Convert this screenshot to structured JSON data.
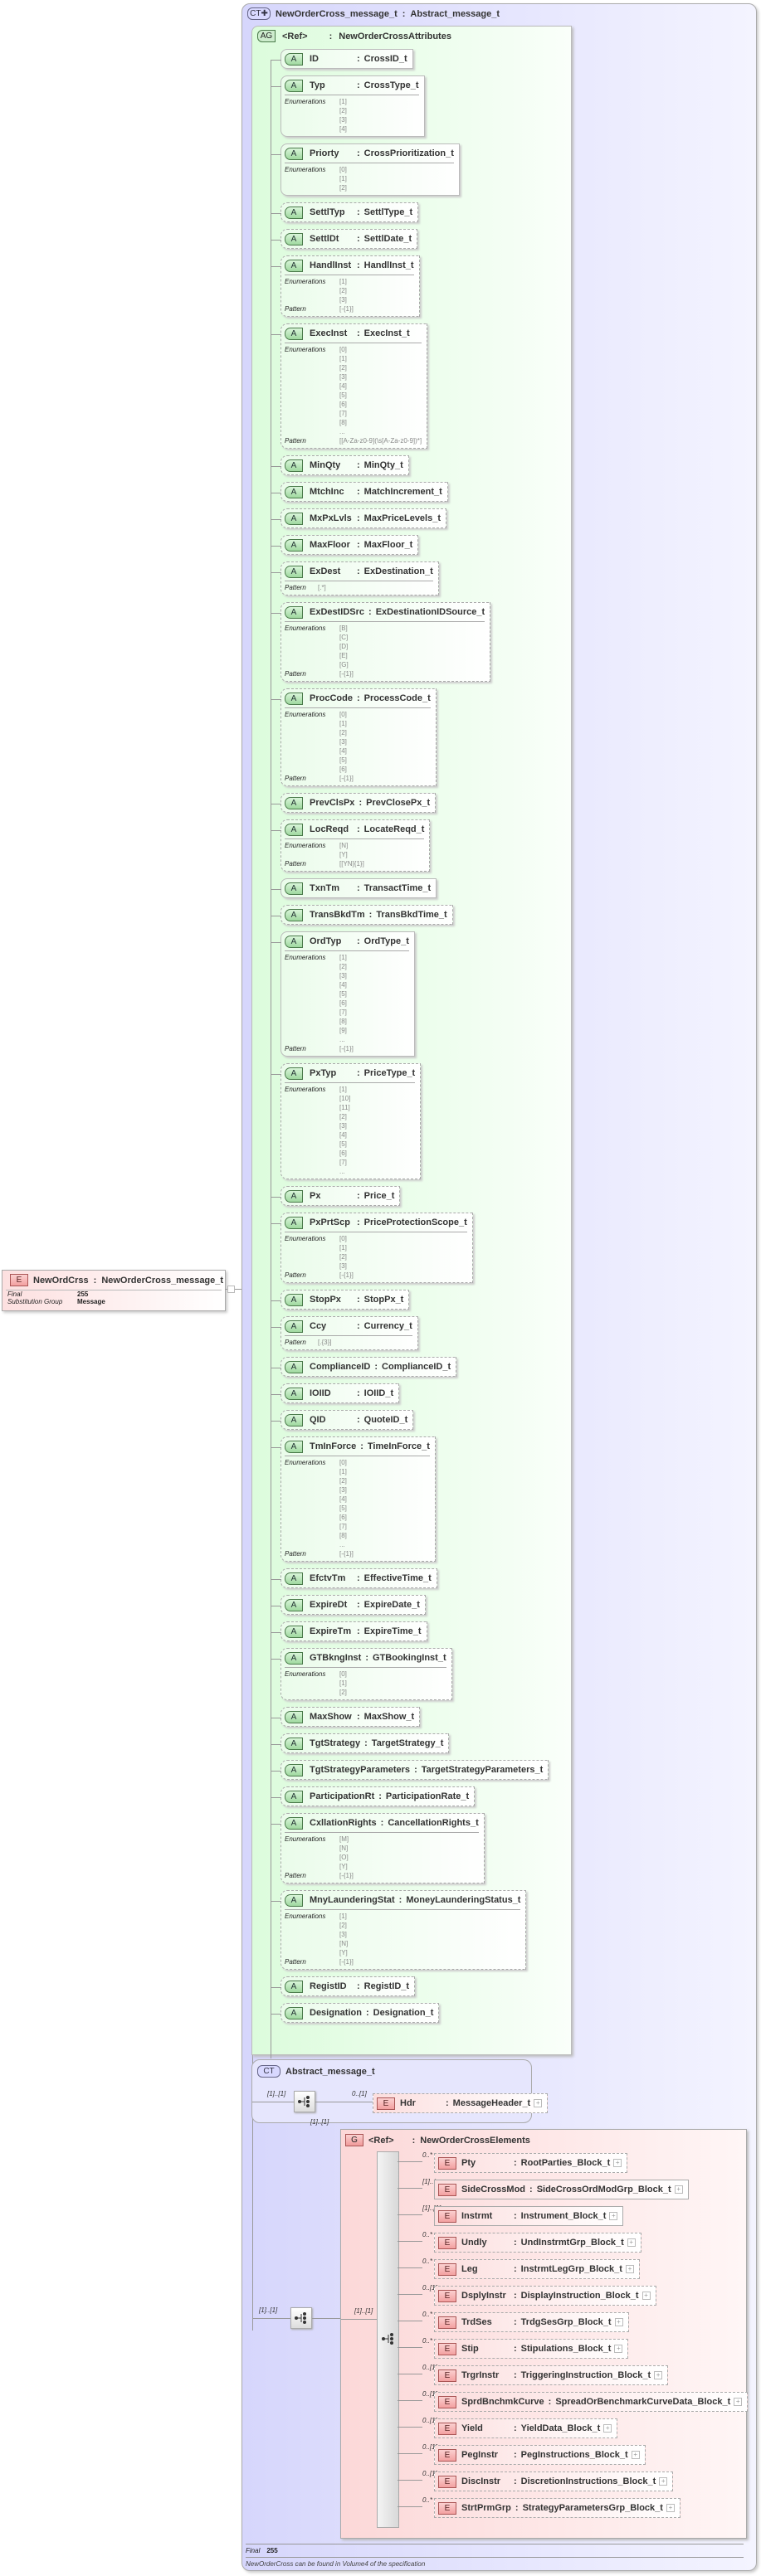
{
  "root_element": {
    "badge": "E",
    "name": "NewOrdCrss",
    "type": "NewOrderCross_message_t",
    "final_label": "Final",
    "final_value": "255",
    "subst_label": "Substitution Group",
    "subst_value": "Message"
  },
  "complex_type": {
    "badge": "CT",
    "name": "NewOrderCross_message_t",
    "base": "Abstract_message_t"
  },
  "attribute_group": {
    "badge": "AG",
    "name": "<Ref>",
    "type": "NewOrderCrossAttributes"
  },
  "attribute_badge": "A",
  "attributes": [
    {
      "name": "ID",
      "type": "CrossID_t",
      "required": true
    },
    {
      "name": "Typ",
      "type": "CrossType_t",
      "required": true,
      "enumerations": [
        "[1]",
        "[2]",
        "[3]",
        "[4]"
      ]
    },
    {
      "name": "Priorty",
      "type": "CrossPrioritization_t",
      "required": true,
      "enumerations": [
        "[0]",
        "[1]",
        "[2]"
      ]
    },
    {
      "name": "SettlTyp",
      "type": "SettlType_t"
    },
    {
      "name": "SettlDt",
      "type": "SettlDate_t"
    },
    {
      "name": "HandlInst",
      "type": "HandlInst_t",
      "enumerations": [
        "[1]",
        "[2]",
        "[3]"
      ],
      "pattern": "[-{1}]"
    },
    {
      "name": "ExecInst",
      "type": "ExecInst_t",
      "enumerations": [
        "[0]",
        "[1]",
        "[2]",
        "[3]",
        "[4]",
        "[5]",
        "[6]",
        "[7]",
        "[8]",
        "..."
      ],
      "pattern": "[[A-Za-z0-9](\\s[A-Za-z0-9])*]"
    },
    {
      "name": "MinQty",
      "type": "MinQty_t"
    },
    {
      "name": "MtchInc",
      "type": "MatchIncrement_t"
    },
    {
      "name": "MxPxLvls",
      "type": "MaxPriceLevels_t"
    },
    {
      "name": "MaxFloor",
      "type": "MaxFloor_t"
    },
    {
      "name": "ExDest",
      "type": "ExDestination_t",
      "pattern": "[.*]"
    },
    {
      "name": "ExDestIDSrc",
      "type": "ExDestinationIDSource_t",
      "enumerations": [
        "[B]",
        "[C]",
        "[D]",
        "[E]",
        "[G]"
      ],
      "pattern": "[-{1}]"
    },
    {
      "name": "ProcCode",
      "type": "ProcessCode_t",
      "enumerations": [
        "[0]",
        "[1]",
        "[2]",
        "[3]",
        "[4]",
        "[5]",
        "[6]"
      ],
      "pattern": "[-{1}]"
    },
    {
      "name": "PrevClsPx",
      "type": "PrevClosePx_t"
    },
    {
      "name": "LocReqd",
      "type": "LocateReqd_t",
      "enumerations": [
        "[N]",
        "[Y]"
      ],
      "pattern": "[[YN]{1}]"
    },
    {
      "name": "TxnTm",
      "type": "TransactTime_t",
      "required": true
    },
    {
      "name": "TransBkdTm",
      "type": "TransBkdTime_t"
    },
    {
      "name": "OrdTyp",
      "type": "OrdType_t",
      "required": true,
      "enumerations": [
        "[1]",
        "[2]",
        "[3]",
        "[4]",
        "[5]",
        "[6]",
        "[7]",
        "[8]",
        "[9]",
        "..."
      ],
      "pattern": "[-{1}]"
    },
    {
      "name": "PxTyp",
      "type": "PriceType_t",
      "enumerations": [
        "[1]",
        "[10]",
        "[11]",
        "[2]",
        "[3]",
        "[4]",
        "[5]",
        "[6]",
        "[7]",
        "..."
      ]
    },
    {
      "name": "Px",
      "type": "Price_t"
    },
    {
      "name": "PxPrtScp",
      "type": "PriceProtectionScope_t",
      "enumerations": [
        "[0]",
        "[1]",
        "[2]",
        "[3]"
      ],
      "pattern": "[-{1}]"
    },
    {
      "name": "StopPx",
      "type": "StopPx_t"
    },
    {
      "name": "Ccy",
      "type": "Currency_t",
      "pattern": "[.{3}]"
    },
    {
      "name": "ComplianceID",
      "type": "ComplianceID_t"
    },
    {
      "name": "IOIID",
      "type": "IOIID_t"
    },
    {
      "name": "QID",
      "type": "QuoteID_t"
    },
    {
      "name": "TmInForce",
      "type": "TimeInForce_t",
      "enumerations": [
        "[0]",
        "[1]",
        "[2]",
        "[3]",
        "[4]",
        "[5]",
        "[6]",
        "[7]",
        "[8]",
        "..."
      ],
      "pattern": "[-{1}]"
    },
    {
      "name": "EfctvTm",
      "type": "EffectiveTime_t"
    },
    {
      "name": "ExpireDt",
      "type": "ExpireDate_t"
    },
    {
      "name": "ExpireTm",
      "type": "ExpireTime_t"
    },
    {
      "name": "GTBkngInst",
      "type": "GTBookingInst_t",
      "enumerations": [
        "[0]",
        "[1]",
        "[2]"
      ]
    },
    {
      "name": "MaxShow",
      "type": "MaxShow_t"
    },
    {
      "name": "TgtStrategy",
      "type": "TargetStrategy_t"
    },
    {
      "name": "TgtStrategyParameters",
      "type": "TargetStrategyParameters_t"
    },
    {
      "name": "ParticipationRt",
      "type": "ParticipationRate_t"
    },
    {
      "name": "CxllationRights",
      "type": "CancellationRights_t",
      "enumerations": [
        "[M]",
        "[N]",
        "[O]",
        "[Y]"
      ],
      "pattern": "[-{1}]"
    },
    {
      "name": "MnyLaunderingStat",
      "type": "MoneyLaunderingStatus_t",
      "enumerations": [
        "[1]",
        "[2]",
        "[3]",
        "[N]",
        "[Y]"
      ],
      "pattern": "[-{1}]"
    },
    {
      "name": "RegistID",
      "type": "RegistID_t"
    },
    {
      "name": "Designation",
      "type": "Designation_t"
    }
  ],
  "labels": {
    "enumerations": "Enumerations",
    "pattern": "Pattern"
  },
  "abstract_type": {
    "badge": "CT",
    "name": "Abstract_message_t",
    "seq_mult": "[1]..[1]",
    "hdr": {
      "badge": "E",
      "mult": "0..[1]",
      "name": "Hdr",
      "type": "MessageHeader_t"
    }
  },
  "outer_seq_mult": "[1]..[1]",
  "group": {
    "badge": "G",
    "name": "<Ref>",
    "type": "NewOrderCrossElements",
    "mult": "[1]..[1]",
    "seq_mult": "[1]..[1]"
  },
  "element_badge": "E",
  "elements": [
    {
      "mult": "0..*",
      "name": "Pty",
      "type": "RootParties_Block_t"
    },
    {
      "mult": "[1]..*",
      "name": "SideCrossMod",
      "type": "SideCrossOrdModGrp_Block_t",
      "required": true
    },
    {
      "mult": "[1]..[1]",
      "name": "Instrmt",
      "type": "Instrument_Block_t",
      "required": true
    },
    {
      "mult": "0..*",
      "name": "Undly",
      "type": "UndInstrmtGrp_Block_t"
    },
    {
      "mult": "0..*",
      "name": "Leg",
      "type": "InstrmtLegGrp_Block_t"
    },
    {
      "mult": "0..[1]",
      "name": "DsplyInstr",
      "type": "DisplayInstruction_Block_t"
    },
    {
      "mult": "0..*",
      "name": "TrdSes",
      "type": "TrdgSesGrp_Block_t"
    },
    {
      "mult": "0..*",
      "name": "Stip",
      "type": "Stipulations_Block_t"
    },
    {
      "mult": "0..[1]",
      "name": "TrgrInstr",
      "type": "TriggeringInstruction_Block_t"
    },
    {
      "mult": "0..[1]",
      "name": "SprdBnchmkCurve",
      "type": "SpreadOrBenchmarkCurveData_Block_t"
    },
    {
      "mult": "0..[1]",
      "name": "Yield",
      "type": "YieldData_Block_t"
    },
    {
      "mult": "0..[1]",
      "name": "PegInstr",
      "type": "PegInstructions_Block_t"
    },
    {
      "mult": "0..[1]",
      "name": "DiscInstr",
      "type": "DiscretionInstructions_Block_t"
    },
    {
      "mult": "0..*",
      "name": "StrtPrmGrp",
      "type": "StrategyParametersGrp_Block_t"
    }
  ],
  "footer": {
    "final_label": "Final",
    "final_value": "255",
    "note": "NewOrderCross can be found in Volume4 of the specification"
  },
  "colon": ":"
}
